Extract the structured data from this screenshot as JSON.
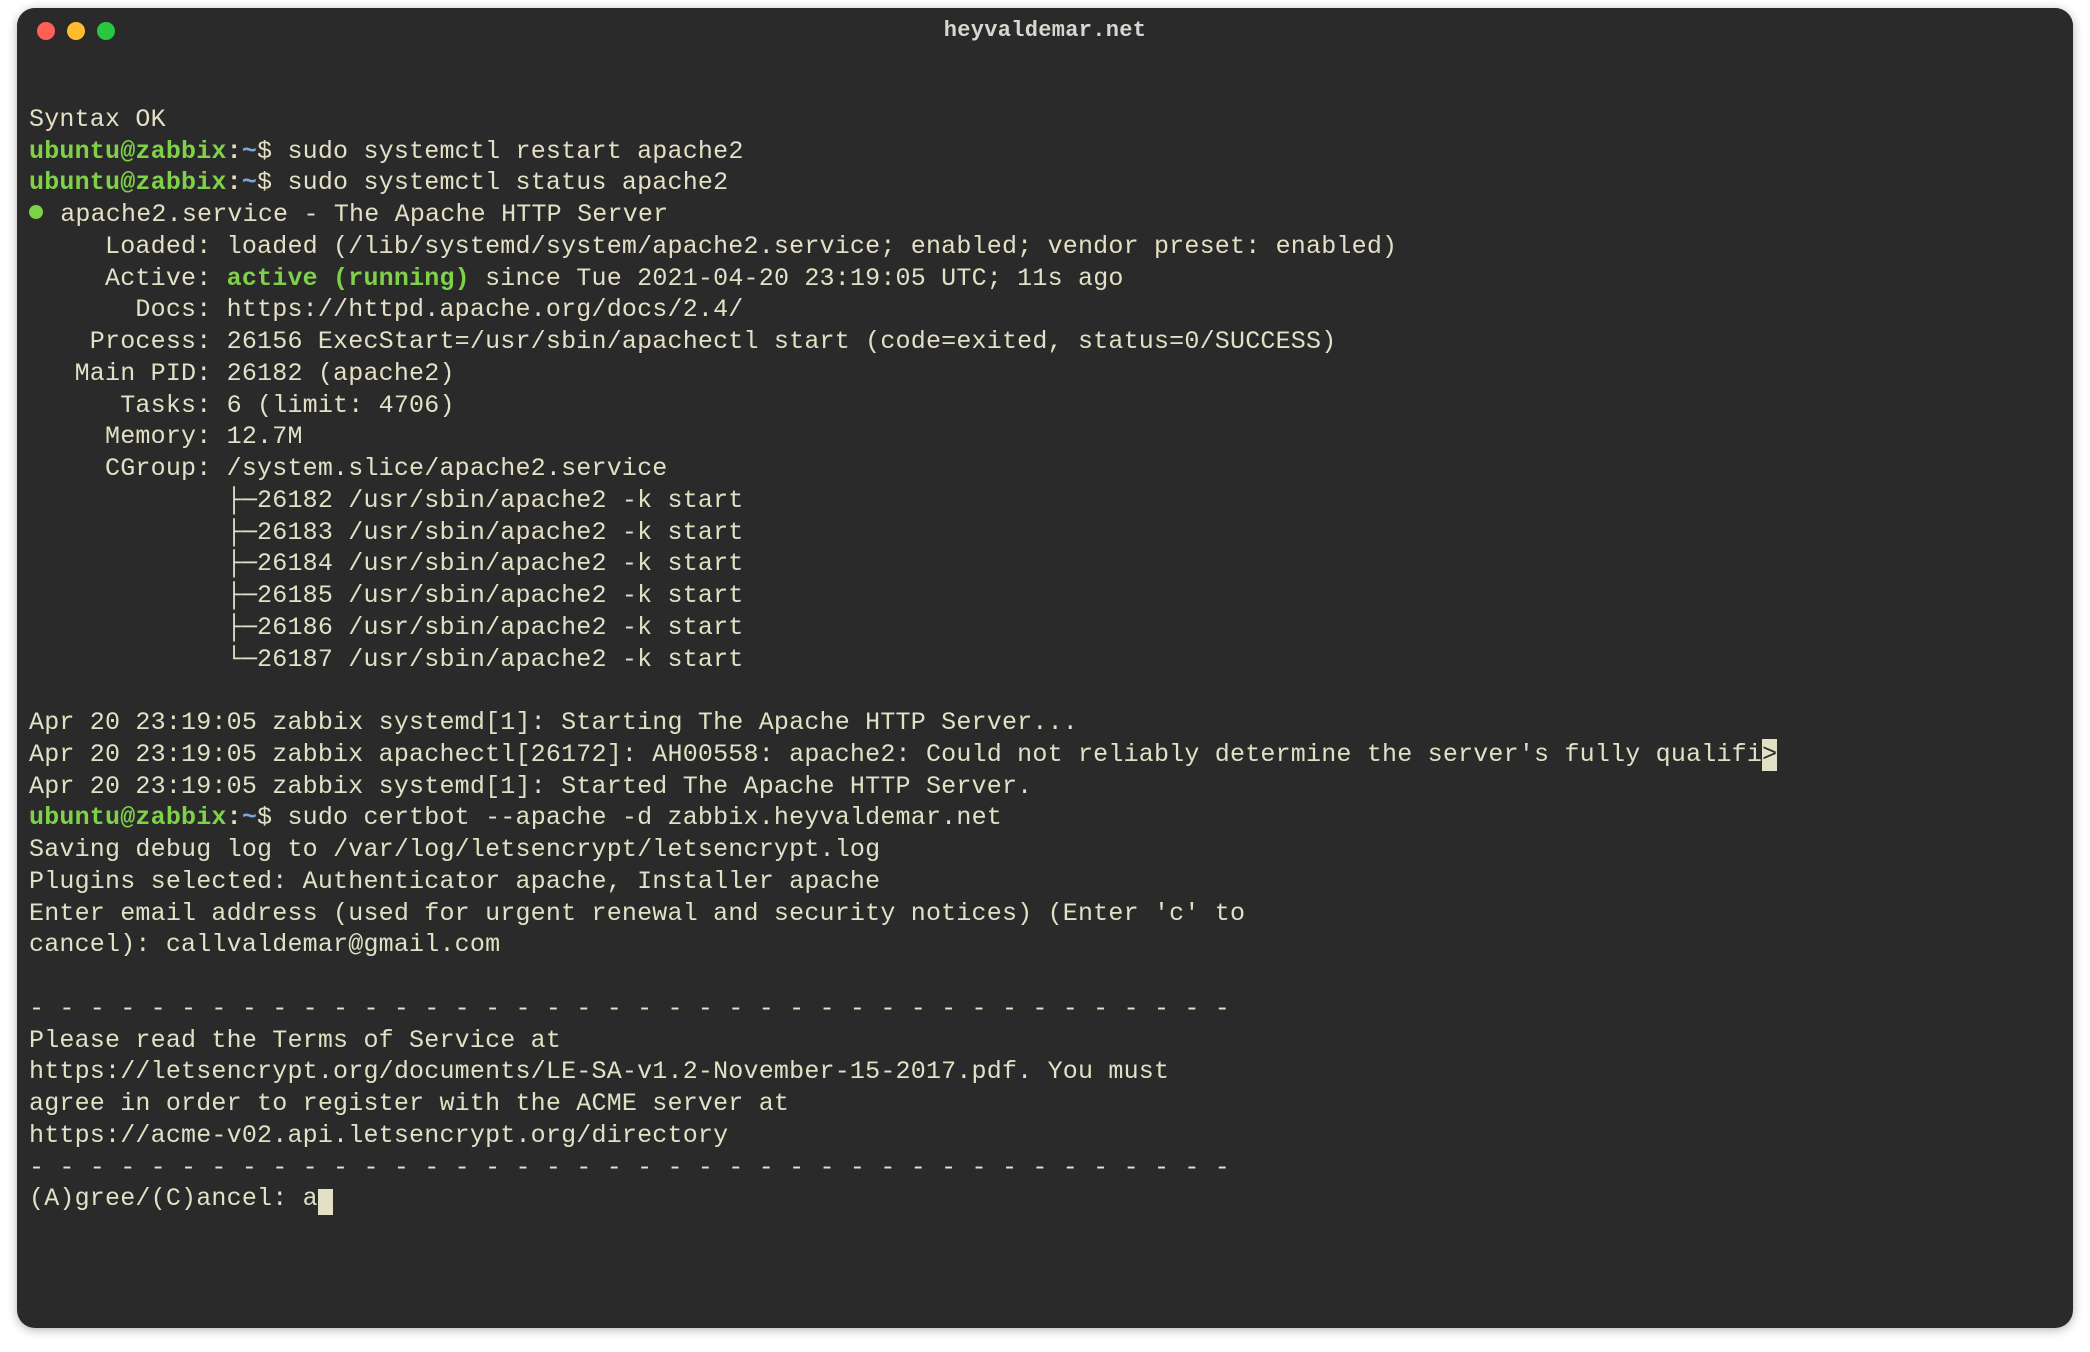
{
  "window": {
    "title": "heyvaldemar.net"
  },
  "colors": {
    "bg": "#2a2a2a",
    "text": "#e2e1c5",
    "green": "#7fd148",
    "blue": "#7aa7d7",
    "red": "#ff5f57",
    "yellow": "#febc2e",
    "green_btn": "#28c840"
  },
  "prompt": {
    "user": "ubuntu@zabbix",
    "sep": ":",
    "path": "~",
    "sign": "$"
  },
  "lines": {
    "syntax_ok": "Syntax OK",
    "cmd1": "sudo systemctl restart apache2",
    "cmd2": "sudo systemctl status apache2",
    "svc_header": " apache2.service - The Apache HTTP Server",
    "loaded": "     Loaded: loaded (/lib/systemd/system/apache2.service; enabled; vendor preset: enabled)",
    "active_l": "     Active: ",
    "active_v": "active (running)",
    "active_r": " since Tue 2021-04-20 23:19:05 UTC; 11s ago",
    "docs": "       Docs: https://httpd.apache.org/docs/2.4/",
    "process": "    Process: 26156 ExecStart=/usr/sbin/apachectl start (code=exited, status=0/SUCCESS)",
    "mainpid": "   Main PID: 26182 (apache2)",
    "tasks": "      Tasks: 6 (limit: 4706)",
    "memory": "     Memory: 12.7M",
    "cgroup": "     CGroup: /system.slice/apache2.service",
    "p1": "             ├─26182 /usr/sbin/apache2 -k start",
    "p2": "             ├─26183 /usr/sbin/apache2 -k start",
    "p3": "             ├─26184 /usr/sbin/apache2 -k start",
    "p4": "             ├─26185 /usr/sbin/apache2 -k start",
    "p5": "             ├─26186 /usr/sbin/apache2 -k start",
    "p6": "             └─26187 /usr/sbin/apache2 -k start",
    "blank": "",
    "log1": "Apr 20 23:19:05 zabbix systemd[1]: Starting The Apache HTTP Server...",
    "log2": "Apr 20 23:19:05 zabbix apachectl[26172]: AH00558: apache2: Could not reliably determine the server's fully qualifi",
    "log2_caret": ">",
    "log3": "Apr 20 23:19:05 zabbix systemd[1]: Started The Apache HTTP Server.",
    "cmd3": "sudo certbot --apache -d zabbix.heyvaldemar.net",
    "cb1": "Saving debug log to /var/log/letsencrypt/letsencrypt.log",
    "cb2": "Plugins selected: Authenticator apache, Installer apache",
    "cb3": "Enter email address (used for urgent renewal and security notices) (Enter 'c' to",
    "cb4": "cancel): callvaldemar@gmail.com",
    "dashes": "- - - - - - - - - - - - - - - - - - - - - - - - - - - - - - - - - - - - - - - -",
    "tos1": "Please read the Terms of Service at",
    "tos2": "https://letsencrypt.org/documents/LE-SA-v1.2-November-15-2017.pdf. You must",
    "tos3": "agree in order to register with the ACME server at",
    "tos4": "https://acme-v02.api.letsencrypt.org/directory",
    "agree_prompt": "(A)gree/(C)ancel: a"
  }
}
